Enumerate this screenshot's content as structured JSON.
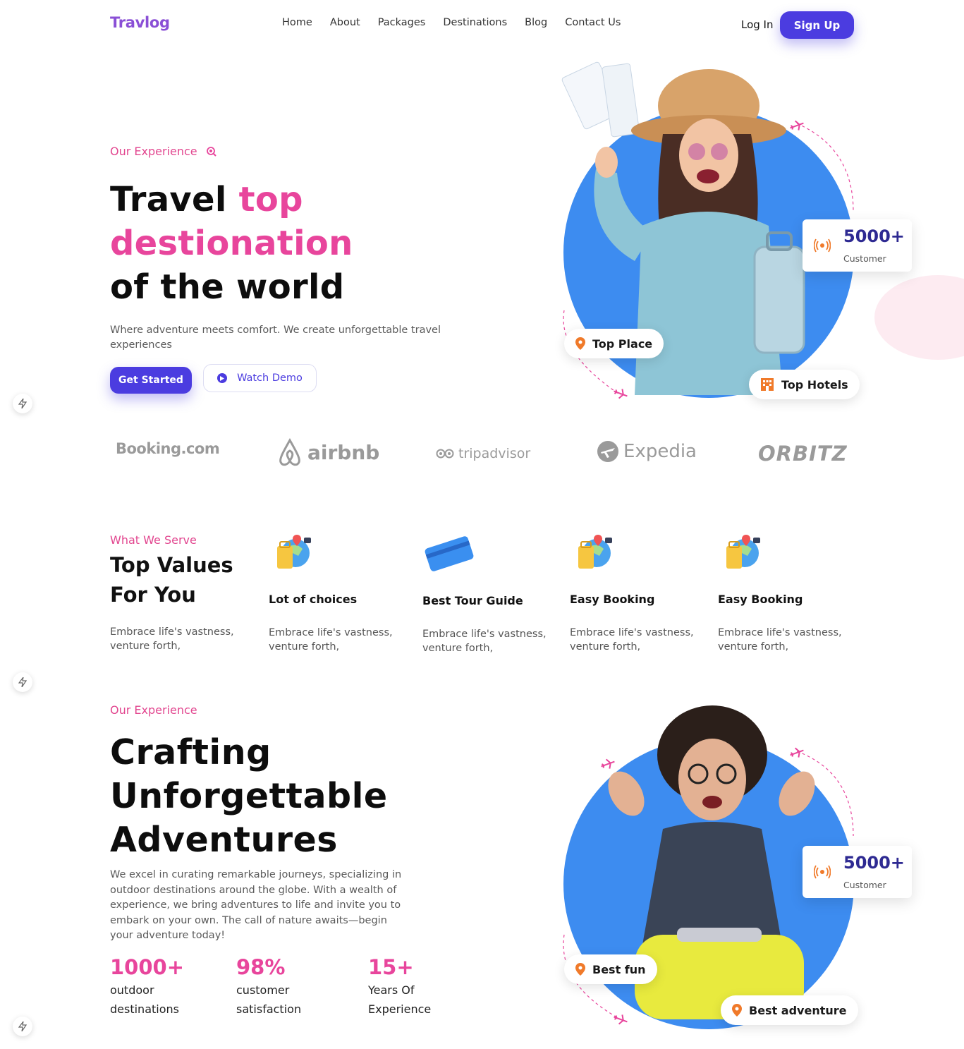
{
  "brand": {
    "name": "Travlog",
    "accent": "#4b3ce0",
    "pink": "#e8459c",
    "blue": "#3d8cf0"
  },
  "nav": {
    "items": [
      "Home",
      "About",
      "Packages",
      "Destinations",
      "Blog",
      "Contact Us"
    ],
    "login": "Log In",
    "signup": "Sign Up"
  },
  "hero": {
    "eyebrow": "Our Experience",
    "title_part1": "Travel ",
    "title_highlight1": "top",
    "title_highlight2": "destionation",
    "title_part3": "of the world",
    "description": "Where adventure meets comfort. We create unforgettable travel experiences",
    "cta_primary": "Get Started",
    "cta_secondary": "Watch Demo",
    "stat_value": "5000+",
    "stat_label": "Customer",
    "badge_place": "Top Place",
    "badge_hotels": "Top Hotels"
  },
  "partners": [
    "Booking.com",
    "airbnb",
    "tripadvisor",
    "Expedia",
    "ORBITZ"
  ],
  "values": {
    "eyebrow": "What We Serve",
    "title_line1": "Top Values",
    "title_line2": "For You",
    "description": "Embrace life's vastness, venture forth,",
    "cards": [
      {
        "title": "Lot of choices",
        "desc": "Embrace life's vastness, venture forth,",
        "icon": "luggage-globe-icon"
      },
      {
        "title": "Best Tour Guide",
        "desc": "Embrace life's vastness, venture forth,",
        "icon": "credit-card-icon"
      },
      {
        "title": "Easy Booking",
        "desc": "Embrace life's vastness, venture forth,",
        "icon": "luggage-globe-icon"
      },
      {
        "title": "Easy Booking",
        "desc": "Embrace life's vastness, venture forth,",
        "icon": "luggage-globe-icon"
      }
    ]
  },
  "adventures": {
    "eyebrow": "Our Experience",
    "title_line1": "Crafting",
    "title_line2": "Unforgettable",
    "title_line3": "Adventures",
    "description": "We excel in curating remarkable journeys, specializing in outdoor destinations around the globe. With a wealth of experience, we bring adventures to life and invite you to embark on your own. The call of nature awaits—begin your adventure today!",
    "metrics": [
      {
        "value": "1000+",
        "line1": "outdoor",
        "line2": "destinations"
      },
      {
        "value": "98%",
        "line1": "customer",
        "line2": "satisfaction"
      },
      {
        "value": "15+",
        "line1": "Years Of",
        "line2": "Experience"
      }
    ],
    "stat_value": "5000+",
    "stat_label": "Customer",
    "badge_fun": "Best fun",
    "badge_adventure": "Best adventure"
  }
}
